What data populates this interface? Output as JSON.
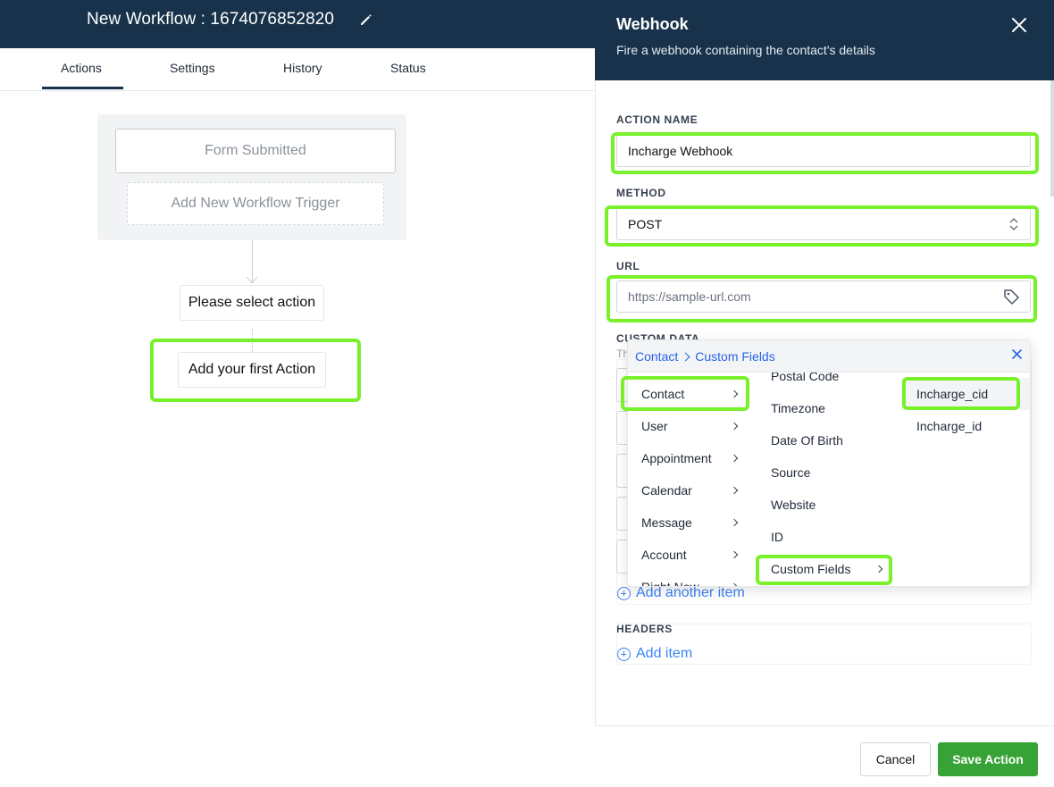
{
  "workflow": {
    "title": "New Workflow : 1674076852820",
    "tabs": [
      "Actions",
      "Settings",
      "History",
      "Status"
    ],
    "active_tab": "Actions",
    "trigger": "Form Submitted",
    "add_trigger": "Add New Workflow Trigger",
    "node_select": "Please select action",
    "node_first": "Add your first Action"
  },
  "panel": {
    "title": "Webhook",
    "subtitle": "Fire a webhook containing the contact's details",
    "action_name_label": "ACTION NAME",
    "action_name_value": "Incharge Webhook",
    "method_label": "METHOD",
    "method_value": "POST",
    "url_label": "URL",
    "url_placeholder": "https://sample-url.com",
    "custom_data_label": "CUSTOM DATA",
    "custom_data_desc": "Th",
    "add_another_item": "Add another item",
    "headers_label": "HEADERS",
    "add_item": "Add item",
    "cancel": "Cancel",
    "save": "Save Action"
  },
  "dropdown": {
    "breadcrumb": [
      "Contact",
      "Custom Fields"
    ],
    "col1": [
      "Contact",
      "User",
      "Appointment",
      "Calendar",
      "Message",
      "Account",
      "Right Now"
    ],
    "col2": [
      "Postal Code",
      "Timezone",
      "Date Of Birth",
      "Source",
      "Website",
      "ID",
      "Custom Fields"
    ],
    "col3": [
      "Incharge_cid",
      "Incharge_id"
    ]
  },
  "colors": {
    "navy": "#17324a",
    "highlight": "#78f02a",
    "save_green": "#37a337",
    "link_blue": "#3b82f6"
  }
}
